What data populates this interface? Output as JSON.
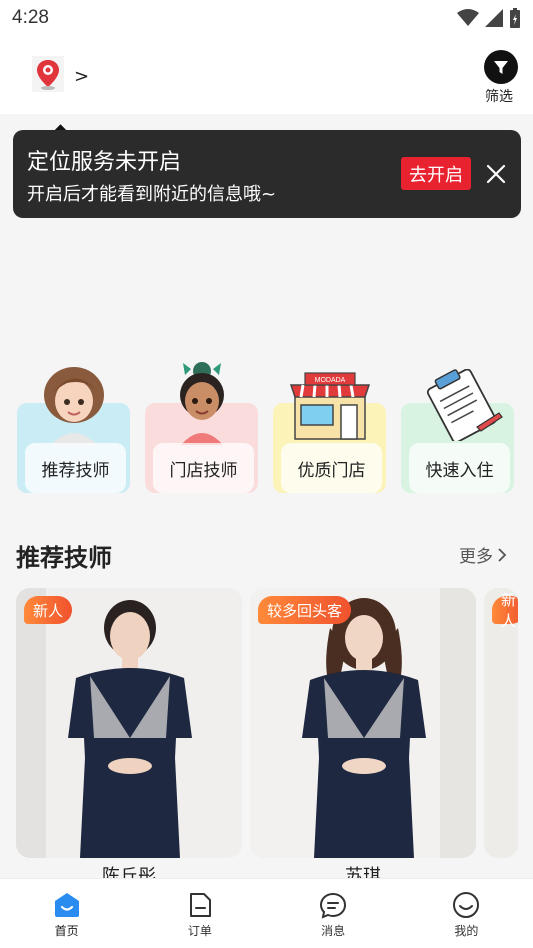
{
  "status_bar": {
    "time": "4:28"
  },
  "header": {
    "location_chevron": ">",
    "filter_label": "筛选"
  },
  "toast": {
    "title": "定位服务未开启",
    "subtitle": "开启后才能看到附近的信息哦~",
    "enable_label": "去开启"
  },
  "categories": [
    {
      "label": "推荐技师",
      "color": "#c9ecf5",
      "icon": "woman-avatar"
    },
    {
      "label": "门店技师",
      "color": "#fbdcdc",
      "icon": "girl-avatar"
    },
    {
      "label": "优质门店",
      "color": "#fbf3b8",
      "icon": "store",
      "sign": "MODADA"
    },
    {
      "label": "快速入住",
      "color": "#d8f3e2",
      "icon": "clipboard"
    }
  ],
  "section": {
    "title": "推荐技师",
    "more_label": "更多"
  },
  "therapists": [
    {
      "tag": "新人",
      "name": "陈丘彤"
    },
    {
      "tag": "较多回头客",
      "name": "苏琪"
    },
    {
      "tag": "新人",
      "name": ""
    }
  ],
  "tabs": [
    {
      "label": "首页",
      "icon": "home-icon",
      "active": true
    },
    {
      "label": "订单",
      "icon": "order-icon",
      "active": false
    },
    {
      "label": "消息",
      "icon": "message-icon",
      "active": false
    },
    {
      "label": "我的",
      "icon": "profile-icon",
      "active": false
    }
  ],
  "colors": {
    "accent": "#2a8cf0",
    "toast_bg": "#2b2b2b",
    "enable_red": "#e8222f",
    "tag_orange": "#f0522e"
  }
}
